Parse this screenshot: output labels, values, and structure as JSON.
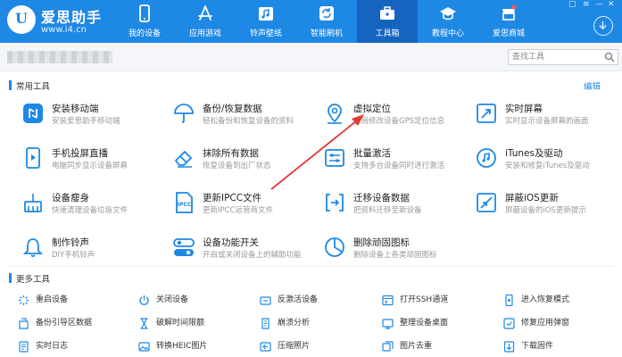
{
  "app": {
    "title": "爱思助手",
    "url": "www.i4.cn",
    "logo_letter": "U"
  },
  "nav": [
    {
      "label": "我的设备",
      "icon": "phone-icon",
      "active": false
    },
    {
      "label": "应用游戏",
      "icon": "app-store-icon",
      "active": false
    },
    {
      "label": "铃声壁纸",
      "icon": "music-icon",
      "active": false
    },
    {
      "label": "智能刷机",
      "icon": "refresh-icon",
      "active": false
    },
    {
      "label": "工具箱",
      "icon": "toolbox-icon",
      "active": true
    },
    {
      "label": "教程中心",
      "icon": "graduation-cap-icon",
      "active": false
    },
    {
      "label": "爱思商城",
      "icon": "shop-icon",
      "active": false
    }
  ],
  "search": {
    "placeholder": "查找工具"
  },
  "common_tools": {
    "title": "常用工具",
    "edit_label": "编辑",
    "items": [
      {
        "name": "安装移动端",
        "desc": "安装爱思助手移动端",
        "icon": "install-mobile-icon"
      },
      {
        "name": "备份/恢复数据",
        "desc": "轻松备份和恢复设备的资料",
        "icon": "umbrella-icon"
      },
      {
        "name": "虚拟定位",
        "desc": "全局修改设备GPS定位信息",
        "icon": "location-pin-icon"
      },
      {
        "name": "实时屏幕",
        "desc": "实时显示设备屏幕的画面",
        "icon": "screen-mirror-icon"
      },
      {
        "name": "手机投屏直播",
        "desc": "电脑同步显示设备屏幕",
        "icon": "phone-cast-icon"
      },
      {
        "name": "抹除所有数据",
        "desc": "恢复设备到出厂状态",
        "icon": "eraser-icon"
      },
      {
        "name": "批量激活",
        "desc": "支持多台设备同时进行激活",
        "icon": "batch-activate-icon"
      },
      {
        "name": "iTunes及驱动",
        "desc": "安装和修复iTunes及驱动",
        "icon": "itunes-icon"
      },
      {
        "name": "设备瘦身",
        "desc": "快速清理设备垃圾文件",
        "icon": "broom-icon"
      },
      {
        "name": "更新IPCC文件",
        "desc": "更新IPCC运营商文件",
        "icon": "ipcc-file-icon"
      },
      {
        "name": "迁移设备数据",
        "desc": "把资料迁移至新设备",
        "icon": "migrate-icon"
      },
      {
        "name": "屏蔽iOS更新",
        "desc": "屏蔽设备的iOS更新提示",
        "icon": "block-update-icon"
      },
      {
        "name": "制作铃声",
        "desc": "DIY手机铃声",
        "icon": "bell-icon"
      },
      {
        "name": "设备功能开关",
        "desc": "开启或关闭设备上的辅助功能",
        "icon": "toggle-icon"
      },
      {
        "name": "删除顽固图标",
        "desc": "删除设备上各类顽固图标",
        "icon": "pie-chart-icon"
      }
    ]
  },
  "more_tools": {
    "title": "更多工具",
    "items": [
      {
        "label": "重启设备",
        "icon": "restart-icon"
      },
      {
        "label": "关闭设备",
        "icon": "power-icon"
      },
      {
        "label": "反激活设备",
        "icon": "deactivate-icon"
      },
      {
        "label": "打开SSH通道",
        "icon": "ssh-icon"
      },
      {
        "label": "进入恢复模式",
        "icon": "recovery-icon"
      },
      {
        "label": "备份引导区数据",
        "icon": "backup-boot-icon"
      },
      {
        "label": "破解时间限额",
        "icon": "hourglass-icon"
      },
      {
        "label": "崩溃分析",
        "icon": "crash-analysis-icon"
      },
      {
        "label": "整理设备桌面",
        "icon": "desktop-organize-icon"
      },
      {
        "label": "修复应用弹窗",
        "icon": "repair-popup-icon"
      },
      {
        "label": "实时日志",
        "icon": "log-icon"
      },
      {
        "label": "转换HEIC图片",
        "icon": "heic-convert-icon"
      },
      {
        "label": "压缩照片",
        "icon": "compress-photo-icon"
      },
      {
        "label": "图片去重",
        "icon": "dedupe-image-icon"
      },
      {
        "label": "下载固件",
        "icon": "download-firmware-icon"
      }
    ]
  },
  "colors": {
    "brand": "#1e88e5",
    "nav_active": "#1565c0",
    "annotation": "#e53935"
  }
}
